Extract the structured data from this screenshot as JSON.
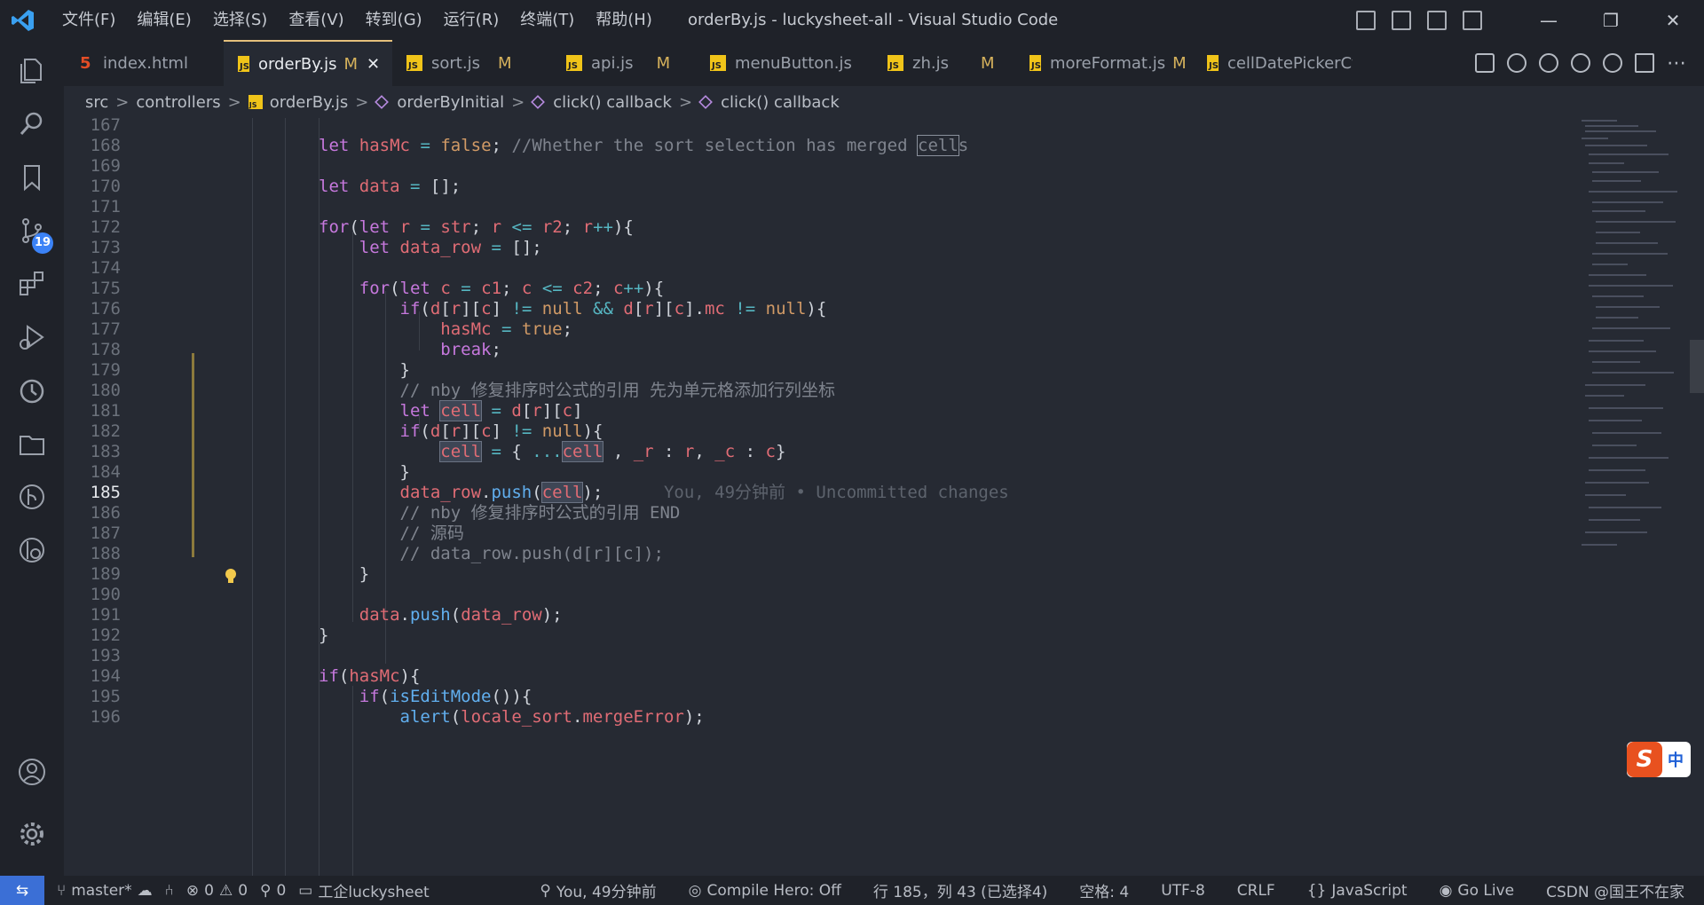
{
  "window": {
    "title": "orderBy.js - luckysheet-all - Visual Studio Code",
    "menu": [
      "文件(F)",
      "编辑(E)",
      "选择(S)",
      "查看(V)",
      "转到(G)",
      "运行(R)",
      "终端(T)",
      "帮助(H)"
    ]
  },
  "activity": {
    "scm_badge": "19"
  },
  "tabs": [
    {
      "label": "index.html",
      "type": "html",
      "mod": ""
    },
    {
      "label": "orderBy.js",
      "type": "js",
      "mod": "M",
      "active": true
    },
    {
      "label": "sort.js",
      "type": "js",
      "mod": "M"
    },
    {
      "label": "api.js",
      "type": "js",
      "mod": "M"
    },
    {
      "label": "menuButton.js",
      "type": "js",
      "mod": ""
    },
    {
      "label": "zh.js",
      "type": "js",
      "mod": "M"
    },
    {
      "label": "moreFormat.js",
      "type": "js",
      "mod": "M"
    },
    {
      "label": "cellDatePickerCt",
      "type": "js",
      "mod": ""
    }
  ],
  "breadcrumb": [
    "src",
    "controllers",
    "orderBy.js",
    "orderByInitial",
    "click() callback",
    "click() callback"
  ],
  "editor": {
    "current_line": "185",
    "blame": "You, 49分钟前 • Uncommitted changes",
    "line_numbers": [
      "167",
      "168",
      "169",
      "170",
      "171",
      "172",
      "173",
      "174",
      "175",
      "176",
      "177",
      "178",
      "179",
      "180",
      "181",
      "182",
      "183",
      "184",
      "185",
      "186",
      "187",
      "188",
      "189",
      "190",
      "191",
      "192",
      "193",
      "194",
      "195",
      "196"
    ]
  },
  "statusbar": {
    "branch": "master*",
    "errors": "0",
    "warnings": "0",
    "ports": "0",
    "folder": "工企luckysheet",
    "blame": "You, 49分钟前",
    "compile_hero": "Compile Hero: Off",
    "position": "行 185，列 43 (已选择4)",
    "spaces": "空格: 4",
    "encoding": "UTF-8",
    "eol": "CRLF",
    "language": "JavaScript",
    "golive": "Go Live",
    "watermark": "CSDN @国王不在家"
  },
  "ime": {
    "label": "中"
  },
  "colors": {
    "accent": "#3b6fd6",
    "keyword": "#c678dd",
    "variable": "#e06c75",
    "function": "#61afef"
  }
}
